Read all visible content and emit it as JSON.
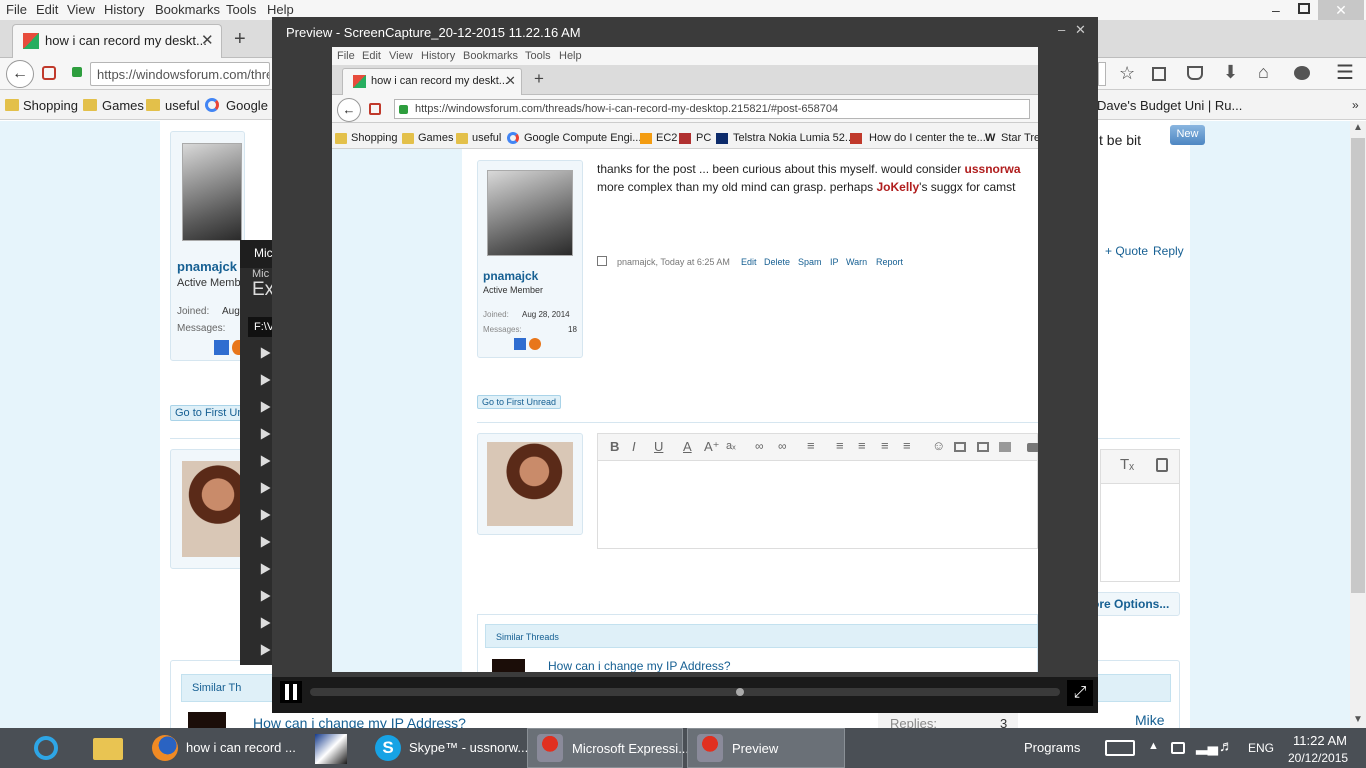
{
  "firefox": {
    "menu": [
      "File",
      "Edit",
      "View",
      "History",
      "Bookmarks",
      "Tools",
      "Help"
    ],
    "tab_title": "how i can record my deskt...",
    "url": "https://windowsforum.com/thre",
    "bookmarks": [
      "Shopping",
      "Games",
      "useful",
      "Google C"
    ],
    "bookmark_right": "Dave's Budget Uni | Ru...",
    "post": {
      "username": "pnamajck",
      "role": "Active Memb",
      "joined_label": "Joined:",
      "joined_value": "Aug",
      "messages_label": "Messages:",
      "text_fragment": "t be bit",
      "new_badge": "New",
      "quote": "+ Quote",
      "reply": "Reply"
    },
    "go_first_unread": "Go to First Un",
    "more_options": "ore Options...",
    "similar_threads_label": "Similar Th",
    "thread_title": "How can i change my IP Address?",
    "replies_label": "Replies:",
    "replies_value": "3",
    "last_poster": "Mike"
  },
  "background_app": {
    "title": "Mic",
    "subtitle_1": "Mic",
    "subtitle_2": "Ex",
    "path": "F:\\V"
  },
  "preview": {
    "title": "Preview - ScreenCapture_20-12-2015 11.22.16 AM",
    "inner": {
      "menu": [
        "File",
        "Edit",
        "View",
        "History",
        "Bookmarks",
        "Tools",
        "Help"
      ],
      "tab_title": "how i can record my deskt...",
      "url": "https://windowsforum.com/threads/how-i-can-record-my-desktop.215821/#post-658704",
      "bookmarks": [
        "Shopping",
        "Games",
        "useful",
        "Google Compute Engi...",
        "EC2",
        "PC",
        "Telstra Nokia Lumia 52...",
        "How do I center the te...",
        "Star Trek"
      ],
      "post_text_1a": "thanks for the post ... been curious about this myself. would consider ",
      "post_text_1b": "ussnorwa",
      "post_text_2a": "more complex than my old mind can grasp. perhaps ",
      "post_text_2b": "JoKelly",
      "post_text_2c": "'s suggx for camst",
      "username": "pnamajck",
      "role": "Active Member",
      "joined_label": "Joined:",
      "joined_value": "Aug 28, 2014",
      "messages_label": "Messages:",
      "messages_value": "18",
      "meta": "pnamajck, Today at 6:25 AM",
      "actions": [
        "Edit",
        "Delete",
        "Spam",
        "IP",
        "Warn",
        "Report"
      ],
      "go_first_unread": "Go to First Unread",
      "similar_threads": "Similar Threads",
      "thread_title": "How can i change my IP Address?"
    }
  },
  "taskbar": {
    "firefox_item": "how i can record ...",
    "skype_item": "Skype™ - ussnorw...",
    "expression_item": "Microsoft Expressi...",
    "preview_item": "Preview",
    "programs": "Programs",
    "language": "ENG",
    "time": "11:22 AM",
    "date": "20/12/2015"
  }
}
